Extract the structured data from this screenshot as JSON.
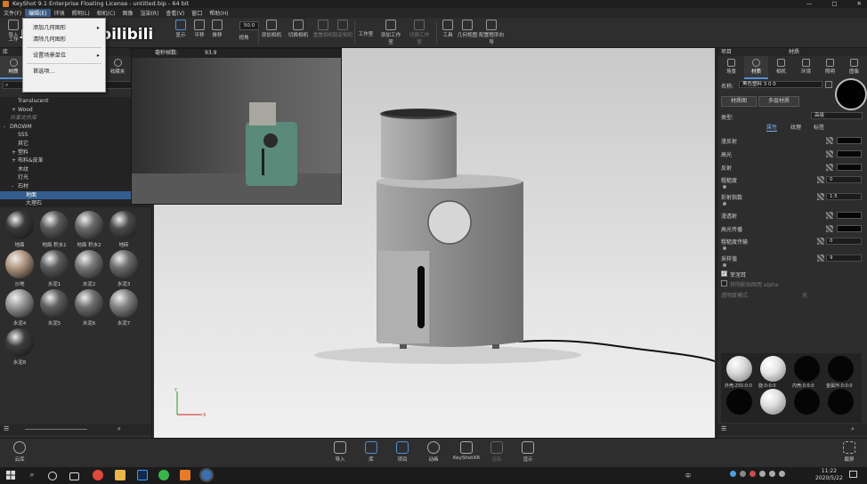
{
  "title_bar": {
    "title": "KeyShot 9.1 Enterprise Floating License - untitled.bip - 64 bit",
    "minimize": "—",
    "maximize": "□",
    "close": "✕"
  },
  "menubar": [
    "文件(F)",
    "编辑(E)",
    "环境",
    "照明(L)",
    "相机(C)",
    "图像",
    "渲染(R)",
    "查看(V)",
    "窗口",
    "帮助(H)"
  ],
  "toolbar": {
    "left_labels": [
      "导入",
      "工作"
    ],
    "buttons": [
      "显示",
      "平移",
      "推移",
      "视角",
      "添加相机",
      "切换相机",
      "重置相机",
      "锁定相机",
      "工作室",
      "添加工作室",
      "切换工作室",
      "工具",
      "几何视图",
      "配置程序向导"
    ],
    "zoom_value": "50.0"
  },
  "watermark": "卓尔谟教育 bilibili",
  "edit_menu": {
    "items": [
      {
        "label": "添加几何图形",
        "has_submenu": true
      },
      {
        "label": "清除几何图形",
        "has_submenu": false
      },
      {
        "label": "设置场景单位",
        "has_submenu": true
      },
      {
        "label": "首选项...",
        "has_submenu": false
      }
    ]
  },
  "left_panel": {
    "title": "库",
    "tabs": [
      "材质",
      "颜色",
      "环境",
      "纹理",
      "收藏夹"
    ],
    "selected_tab": "材质",
    "tree": [
      {
        "label": "Translucent",
        "indent": 1,
        "prefix": "",
        "selected": false
      },
      {
        "label": "Wood",
        "indent": 1,
        "prefix": "+",
        "selected": false
      },
      {
        "label": "共享文件库",
        "indent": 0,
        "prefix": "",
        "selected": false
      },
      {
        "label": "DROWM",
        "indent": 0,
        "prefix": "-",
        "selected": false
      },
      {
        "label": "SSS",
        "indent": 1,
        "prefix": "",
        "selected": false
      },
      {
        "label": "其它",
        "indent": 1,
        "prefix": "",
        "selected": false
      },
      {
        "label": "塑料",
        "indent": 1,
        "prefix": "+",
        "selected": false
      },
      {
        "label": "布料&皮革",
        "indent": 1,
        "prefix": "+",
        "selected": false
      },
      {
        "label": "木纹",
        "indent": 1,
        "prefix": "",
        "selected": false
      },
      {
        "label": "灯光",
        "indent": 1,
        "prefix": "",
        "selected": false
      },
      {
        "label": "石材",
        "indent": 1,
        "prefix": "-",
        "selected": false
      },
      {
        "label": "地面",
        "indent": 2,
        "prefix": "",
        "selected": true
      },
      {
        "label": "大理石",
        "indent": 2,
        "prefix": "",
        "selected": false
      }
    ],
    "swatches": [
      {
        "label": "地面",
        "color": "#3a3a3a"
      },
      {
        "label": "地面 积水1",
        "color": "#5a5a5a"
      },
      {
        "label": "地面 积水2",
        "color": "#6b6b6b"
      },
      {
        "label": "地砖",
        "color": "#4a4a4a"
      },
      {
        "label": "沙地",
        "color": "#b59a82"
      },
      {
        "label": "水泥1",
        "color": "#5c5c5c"
      },
      {
        "label": "水泥2",
        "color": "#7a7a7a"
      },
      {
        "label": "水泥3",
        "color": "#6e6e6e"
      },
      {
        "label": "水泥4",
        "color": "#9a9a9a"
      },
      {
        "label": "水泥5",
        "color": "#606060"
      },
      {
        "label": "水泥6",
        "color": "#707070"
      },
      {
        "label": "水泥7",
        "color": "#858585"
      },
      {
        "label": "水泥8",
        "color": "#3d3d3d"
      }
    ]
  },
  "preview": {
    "caption": "毫秒帧数:",
    "value": "93.9"
  },
  "right_panel": {
    "title": "项目",
    "subtitle": "材质",
    "tabs": [
      "场景",
      "材质",
      "相机",
      "环境",
      "照明",
      "图像"
    ],
    "selected_tab": "材质",
    "name_label": "名称:",
    "name_value": "黑色塑料 3 0 0",
    "buttons": [
      "材质图",
      "多层材质"
    ],
    "type_label": "类型:",
    "type_value": "高级",
    "subtabs": [
      "属性",
      "纹理",
      "标签"
    ],
    "properties": [
      {
        "label": "漫反射",
        "kind": "color",
        "value": ""
      },
      {
        "label": "高光",
        "kind": "color",
        "value": ""
      },
      {
        "label": "反射",
        "kind": "color",
        "value": ""
      },
      {
        "label": "粗糙度",
        "kind": "number",
        "value": "0"
      },
      {
        "label": "折射指数",
        "kind": "number",
        "value": "1.5"
      },
      {
        "label": "漫透射",
        "kind": "color",
        "value": ""
      },
      {
        "label": "高光传播",
        "kind": "color",
        "value": ""
      },
      {
        "label": "粗糙度传输",
        "kind": "number",
        "value": "0"
      },
      {
        "label": "采样值",
        "kind": "number",
        "value": "9"
      }
    ],
    "checkboxes": [
      {
        "label": "菲涅耳",
        "checked": true
      },
      {
        "label": "将阴影贴图用 alpha",
        "checked": false
      }
    ],
    "transparency_label": "透明度模式",
    "transparency_value": "无",
    "materials": [
      {
        "label": "外壳:255:0:0",
        "color": "#d8d8d8"
      },
      {
        "label": "旋:0:0:0",
        "color": "#e5e5e5"
      },
      {
        "label": "内壳:0:0:0",
        "color": "#050505"
      },
      {
        "label": "金属环:0:0:0",
        "color": "#050505"
      },
      {
        "label": "",
        "color": "#050505"
      },
      {
        "label": "",
        "color": "#dddddd"
      },
      {
        "label": "",
        "color": "#050505"
      },
      {
        "label": "",
        "color": "#050505"
      }
    ]
  },
  "bottom_bar": {
    "left_button": "云库",
    "buttons": [
      "导入",
      "库",
      "项目",
      "动画",
      "KeyShotXR",
      "渲染",
      "渲示"
    ],
    "selected": [
      "库",
      "项目"
    ],
    "right_button": "截屏"
  },
  "taskbar": {
    "time": "11:22",
    "date": "2020/5/22",
    "lang": "中"
  }
}
